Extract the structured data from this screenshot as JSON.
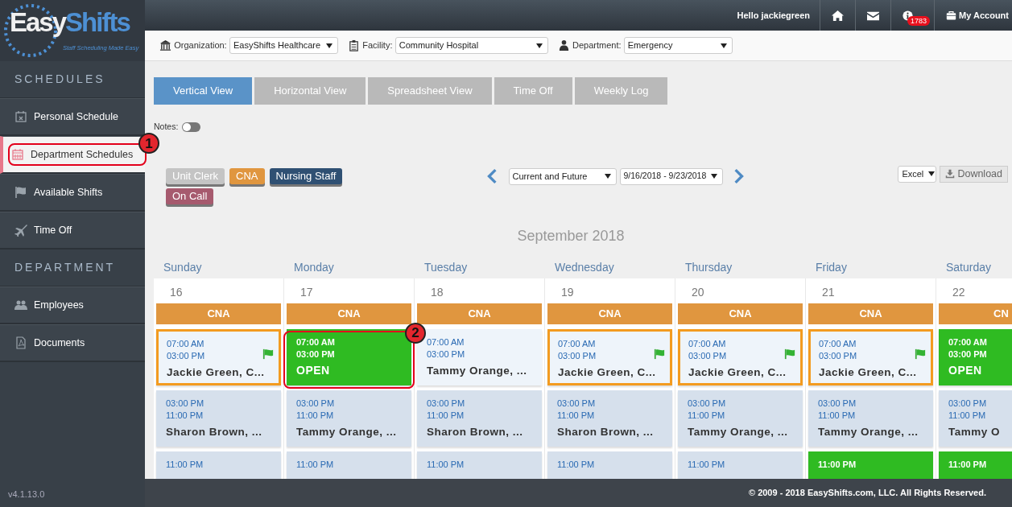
{
  "logo": {
    "brand_first": "Easy",
    "brand_second": "Shifts",
    "tagline": "Staff Scheduling Made Easy"
  },
  "sidebar": {
    "sections": [
      {
        "title": "SCHEDULES",
        "items": [
          {
            "label": "Personal Schedule",
            "selected": false
          },
          {
            "label": "Department Schedules",
            "selected": true,
            "callout": "1"
          },
          {
            "label": "Available Shifts",
            "selected": false
          },
          {
            "label": "Time Off",
            "selected": false
          }
        ]
      },
      {
        "title": "DEPARTMENT",
        "items": [
          {
            "label": "Employees",
            "selected": false
          },
          {
            "label": "Documents",
            "selected": false
          }
        ]
      }
    ],
    "version": "v4.1.13.0"
  },
  "topbar": {
    "greeting": "Hello jackiegreen",
    "notification_count": "1783",
    "account": "My Account"
  },
  "filters": [
    {
      "label": "Organization:",
      "value": "EasyShifts Healthcare"
    },
    {
      "label": "Facility:",
      "value": "Community Hospital"
    },
    {
      "label": "Department:",
      "value": "Emergency"
    }
  ],
  "tabs": [
    {
      "label": "Vertical View",
      "selected": true
    },
    {
      "label": "Horizontal View",
      "selected": false
    },
    {
      "label": "Spreadsheet View",
      "selected": false
    },
    {
      "label": "Time Off",
      "selected": false
    },
    {
      "label": "Weekly Log",
      "selected": false
    }
  ],
  "notes": {
    "label": "Notes:",
    "on": false
  },
  "legend": [
    {
      "label": "Unit Clerk",
      "color": "#c4c4c4"
    },
    {
      "label": "CNA",
      "color": "#e0963f"
    },
    {
      "label": "Nursing Staff",
      "color": "#2f5073"
    },
    {
      "label": "On Call",
      "color": "#a65a6e"
    }
  ],
  "range": {
    "mode": "Current and Future",
    "dates": "9/16/2018 - 9/23/2018"
  },
  "export": {
    "format": "Excel",
    "button": "Download"
  },
  "calendar": {
    "month": "September 2018",
    "days": [
      {
        "name": "Sunday",
        "date": "16",
        "group": "CNA",
        "shifts": [
          {
            "kind": "mine",
            "flagged": true,
            "start": "07:00 AM",
            "end": "03:00 PM",
            "name": "Jackie Green, C..."
          },
          {
            "kind": "regular",
            "start": "03:00 PM",
            "end": "11:00 PM",
            "name": "Sharon Brown, ..."
          },
          {
            "kind": "regular",
            "start": "11:00 PM"
          }
        ]
      },
      {
        "name": "Monday",
        "date": "17",
        "group": "CNA",
        "shifts": [
          {
            "kind": "open",
            "start": "07:00 AM",
            "end": "03:00 PM",
            "name": "OPEN",
            "callout": "2"
          },
          {
            "kind": "regular",
            "start": "03:00 PM",
            "end": "11:00 PM",
            "name": "Tammy Orange, ..."
          },
          {
            "kind": "regular",
            "start": "11:00 PM"
          }
        ]
      },
      {
        "name": "Tuesday",
        "date": "18",
        "group": "CNA",
        "shifts": [
          {
            "kind": "light",
            "start": "07:00 AM",
            "end": "03:00 PM",
            "name": "Tammy Orange, ..."
          },
          {
            "kind": "regular",
            "start": "03:00 PM",
            "end": "11:00 PM",
            "name": "Sharon Brown, ..."
          },
          {
            "kind": "regular",
            "start": "11:00 PM"
          }
        ]
      },
      {
        "name": "Wednesday",
        "date": "19",
        "group": "CNA",
        "shifts": [
          {
            "kind": "mine",
            "flagged": true,
            "start": "07:00 AM",
            "end": "03:00 PM",
            "name": "Jackie Green, C..."
          },
          {
            "kind": "regular",
            "start": "03:00 PM",
            "end": "11:00 PM",
            "name": "Sharon Brown, ..."
          },
          {
            "kind": "regular",
            "start": "11:00 PM"
          }
        ]
      },
      {
        "name": "Thursday",
        "date": "20",
        "group": "CNA",
        "shifts": [
          {
            "kind": "mine",
            "flagged": true,
            "start": "07:00 AM",
            "end": "03:00 PM",
            "name": "Jackie Green, C..."
          },
          {
            "kind": "regular",
            "start": "03:00 PM",
            "end": "11:00 PM",
            "name": "Tammy Orange, ..."
          },
          {
            "kind": "regular",
            "start": "11:00 PM"
          }
        ]
      },
      {
        "name": "Friday",
        "date": "21",
        "group": "CNA",
        "shifts": [
          {
            "kind": "mine",
            "flagged": true,
            "start": "07:00 AM",
            "end": "03:00 PM",
            "name": "Jackie Green, C..."
          },
          {
            "kind": "regular",
            "start": "03:00 PM",
            "end": "11:00 PM",
            "name": "Tammy Orange, ..."
          },
          {
            "kind": "open",
            "start": "11:00 PM"
          }
        ]
      },
      {
        "name": "Saturday",
        "date": "22",
        "group": "CN",
        "shifts": [
          {
            "kind": "open",
            "start": "07:00 AM",
            "end": "03:00 PM",
            "name": "OPEN"
          },
          {
            "kind": "regular",
            "start": "03:00 PM",
            "end": "11:00 PM",
            "name": "Tammy O"
          },
          {
            "kind": "open",
            "start": "11:00 PM"
          }
        ]
      }
    ]
  },
  "footer": {
    "copyright": "© 2009 - 2018 EasyShifts.com, LLC. All Rights Reserved."
  }
}
